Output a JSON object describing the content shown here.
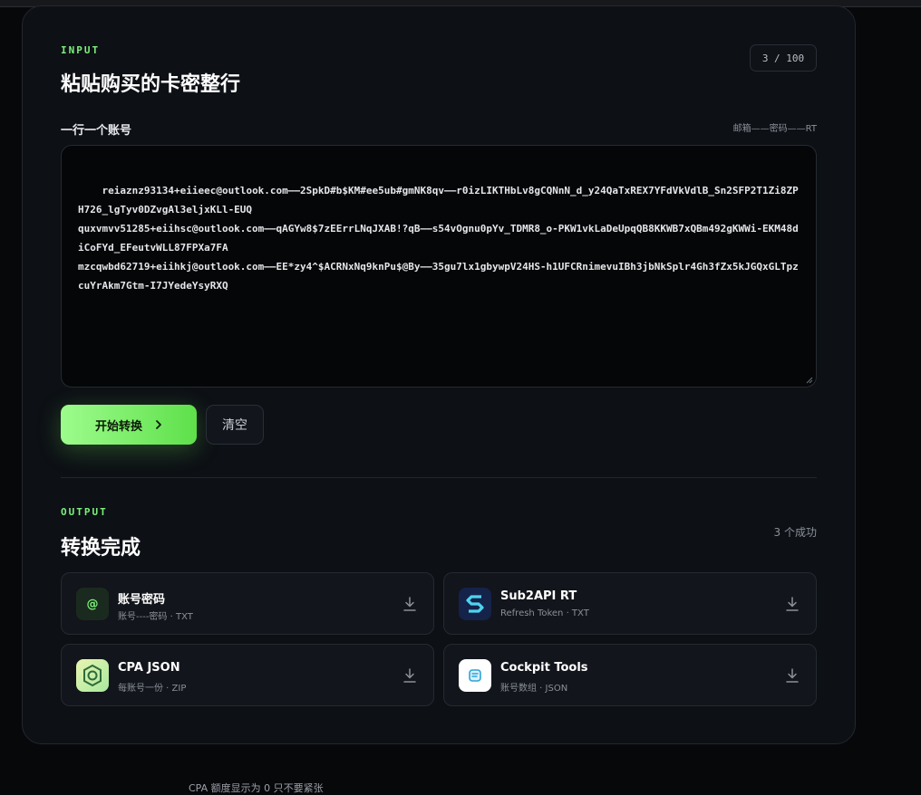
{
  "input": {
    "section_label": "INPUT",
    "title": "粘贴购买的卡密整行",
    "counter": "3 / 100",
    "field_label": "一行一个账号",
    "field_hint": "邮箱——密码——RT",
    "textarea_value": "reiaznz93134+eiieec@outlook.com——2SpkD#b$KM#ee5ub#gmNK8qv——r0izLIKTHbLv8gCQNnN_d_y24QaTxREX7YFdVkVdlB_Sn2SFP2T1Zi8ZPH726_lgTyv0DZvgAl3eljxKLl-EUQ\nquxvmvv51285+eiihsc@outlook.com——qAGYw8$7zEErrLNqJXAB!?qB——s54vOgnu0pYv_TDMR8_o-PKW1vkLaDeUpqQB8KKWB7xQBm492gKWWi-EKM48diCoFYd_EFeutvWLL87FPXa7FA\nmzcqwbd62719+eiihkj@outlook.com——EE*zy4^$ACRNxNq9knPu$@By——35gu7lx1gbywpV24HS-h1UFCRnimevuIBh3jbNkSplr4Gh3fZx5kJGQxGLTpzcuYrAkm7Gtm-I7JYedeYsyRXQ",
    "start_button": "开始转换",
    "clear_button": "清空"
  },
  "output": {
    "section_label": "OUTPUT",
    "title": "转换完成",
    "success": "3 个成功",
    "items": [
      {
        "name": "账号密码",
        "desc": "账号----密码 · TXT",
        "icon": "at-icon"
      },
      {
        "name": "Sub2API RT",
        "desc": "Refresh Token · TXT",
        "icon": "sub2api-logo-icon"
      },
      {
        "name": "CPA JSON",
        "desc": "每账号一份 · ZIP",
        "icon": "cpa-logo-icon"
      },
      {
        "name": "Cockpit Tools",
        "desc": "账号数组 · JSON",
        "icon": "cockpit-logo-icon"
      }
    ]
  },
  "footer": {
    "text": "CPA 额度显示为 0 只不要紧张"
  },
  "colors": {
    "accent": "#7cf07a",
    "card_bg": "#0d1015",
    "page_bg": "#07080a"
  }
}
